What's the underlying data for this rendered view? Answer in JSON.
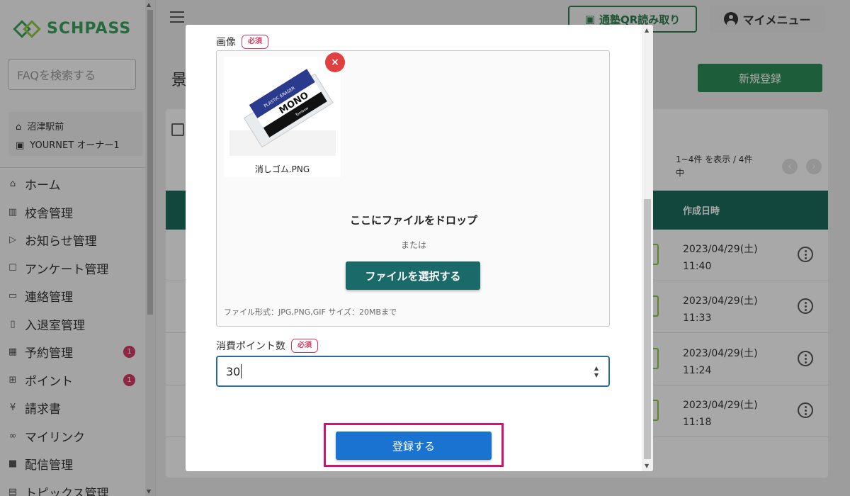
{
  "sidebar": {
    "logo": "SCHPASS",
    "faq_placeholder": "FAQを検索する",
    "school": "沼津駅前",
    "user": "YOURNET オーナー1",
    "items": [
      {
        "label": "ホーム",
        "icon": "home-icon"
      },
      {
        "label": "校舎管理",
        "icon": "building-icon"
      },
      {
        "label": "お知らせ管理",
        "icon": "send-icon"
      },
      {
        "label": "アンケート管理",
        "icon": "survey-icon"
      },
      {
        "label": "連絡管理",
        "icon": "chat-icon"
      },
      {
        "label": "入退室管理",
        "icon": "door-icon"
      },
      {
        "label": "予約管理",
        "icon": "calendar-icon",
        "badge": "1"
      },
      {
        "label": "ポイント",
        "icon": "gift-icon",
        "badge": "1"
      },
      {
        "label": "請求書",
        "icon": "yen-icon"
      },
      {
        "label": "マイリンク",
        "icon": "link-icon"
      },
      {
        "label": "配信管理",
        "icon": "broadcast-icon"
      },
      {
        "label": "トピックス管理",
        "icon": "topics-icon"
      }
    ]
  },
  "header": {
    "qr_button": "通塾QR読み取り",
    "my_menu": "マイメニュー"
  },
  "page": {
    "title_fragment": "景",
    "new_button": "新規登録",
    "count_text": "1~4件 を表示 / 4件中",
    "col_created": "作成日時",
    "rows": [
      {
        "date": "2023/04/29(土)",
        "time": "11:40"
      },
      {
        "date": "2023/04/29(土)",
        "time": "11:33"
      },
      {
        "date": "2023/04/29(土)",
        "time": "11:24"
      },
      {
        "date": "2023/04/29(土)",
        "time": "11:18"
      }
    ]
  },
  "modal": {
    "image_label": "画像",
    "required": "必須",
    "file_name": "消しゴム.PNG",
    "drop_title": "ここにファイルをドロップ",
    "drop_or": "または",
    "select_file": "ファイルを選択する",
    "file_hint": "ファイル形式：JPG,PNG,GIF サイズ：20MBまで",
    "points_label": "消費ポイント数",
    "points_value": "30",
    "submit": "登録する"
  },
  "colors": {
    "brand_green": "#2e8b57",
    "header_teal": "#1b6a5b",
    "required_pink": "#d23a5f",
    "submit_blue": "#1a73d1",
    "highlight_magenta": "#d0166a"
  }
}
